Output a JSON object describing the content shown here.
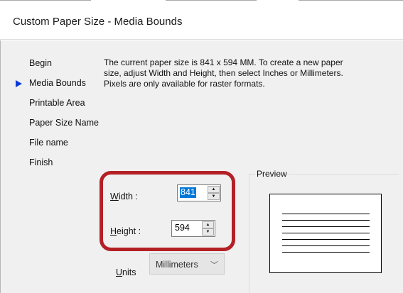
{
  "dialog": {
    "title": "Custom Paper Size - Media Bounds"
  },
  "nav": {
    "items": [
      {
        "label": "Begin"
      },
      {
        "label": "Media Bounds",
        "current": true
      },
      {
        "label": "Printable Area"
      },
      {
        "label": "Paper Size Name"
      },
      {
        "label": "File name"
      },
      {
        "label": "Finish"
      }
    ]
  },
  "description": {
    "line1": "The current paper size is 841 x 594 MM. To create a new paper",
    "line2": "size, adjust Width and Height, then select Inches or Millimeters.",
    "line3": "Pixels are only available for raster formats."
  },
  "width": {
    "label_access": "W",
    "label_rest": "idth :",
    "value": "841"
  },
  "height": {
    "label_access": "H",
    "label_rest": "eight :",
    "value": "594"
  },
  "units": {
    "label_access": "U",
    "label_rest": "nits",
    "selected": "Millimeters"
  },
  "preview": {
    "label": "Preview"
  },
  "colors": {
    "highlight": "#b32025",
    "selection": "#0078d7",
    "nav_arrow": "#0b3bd6",
    "dialog_bg": "#f0f0f0"
  }
}
